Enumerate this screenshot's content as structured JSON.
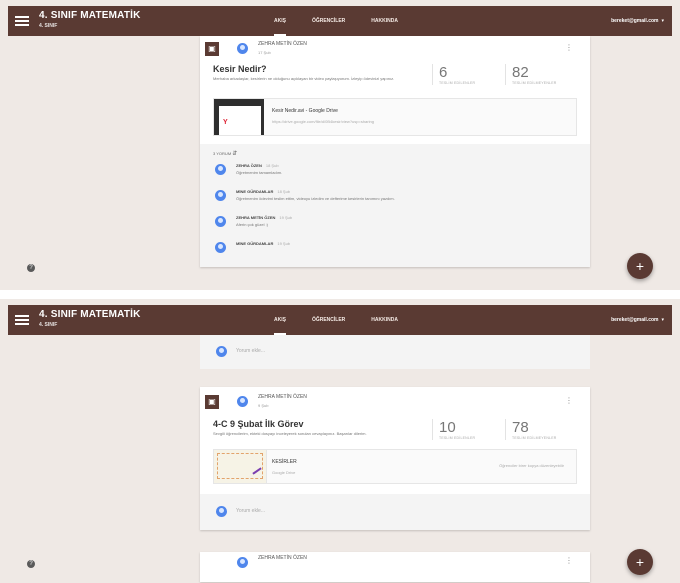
{
  "header": {
    "class_name": "4. SINIF MATEMATİK",
    "class_sub": "4. SINIF",
    "tabs": [
      "AKIŞ",
      "ÖĞRENCİLER",
      "HAKKINDA"
    ],
    "account": "bereket@gmail.com",
    "account_caret": "▾"
  },
  "icons": {
    "help": "?",
    "fab": "+",
    "more": "⋮",
    "post": "▣"
  },
  "panel1": {
    "post": {
      "author": "ZEHRA METİN ÖZEN",
      "date": "17 Şub",
      "title": "Kesir Nedir?",
      "text": "Merhaba arkadaşlar, kesirlerin ne olduğunu açıklayan bir video paylaşıyorum. İzleyip ödevinizi yapınız.",
      "stats": [
        {
          "value": "6",
          "label": "TESLİM EDİLENLER"
        },
        {
          "value": "82",
          "label": "TESLİM EDİLMEYENLER"
        }
      ],
      "attachment": {
        "title": "Kesir Nedir.avi - Google Drive",
        "url": "https://drive.google.com/file/d/0B4kesir/view?usp=sharing"
      }
    },
    "comments_header": "3 YORUM",
    "comments_arrow": "⇵",
    "comments": [
      {
        "author": "ZEHRA ÖZEN",
        "time": "18 Şub",
        "text": "Öğretmenim tamamladım."
      },
      {
        "author": "MİNE GÜRDAMLAR",
        "time": "18 Şub",
        "text": "Öğretmenim ödevimi teslim ettim, videoyu izledim ve defterime kesirlerin tanımını yazdım."
      },
      {
        "author": "ZEHRA METİN ÖZEN",
        "time": "19 Şub",
        "text": "Aferin çok güzel :)"
      },
      {
        "author": "MİNE GÜRDAMLAR",
        "time": "19 Şub",
        "text": ""
      }
    ]
  },
  "panel2": {
    "comment_placeholder": "Yorum ekle...",
    "post": {
      "author": "ZEHRA METİN ÖZEN",
      "date": "9 Şub",
      "title": "4-C 9 Şubat İlk Görev",
      "text": "Sevgili öğrencilerim, ekteki dosyayı inceleyerek soruları cevaplayınız. Başarılar dilerim.",
      "stats": [
        {
          "value": "10",
          "label": "TESLİM EDİLENLER"
        },
        {
          "value": "78",
          "label": "TESLİM EDİLMEYENLER"
        }
      ],
      "attachment": {
        "title": "KESİRLER",
        "url": "Google Drive",
        "action": "Öğrenciler birer kopya düzenleyebilir"
      }
    },
    "comment_placeholder_2": "Yorum ekle...",
    "next_post_author": "ZEHRA METİN ÖZEN"
  }
}
